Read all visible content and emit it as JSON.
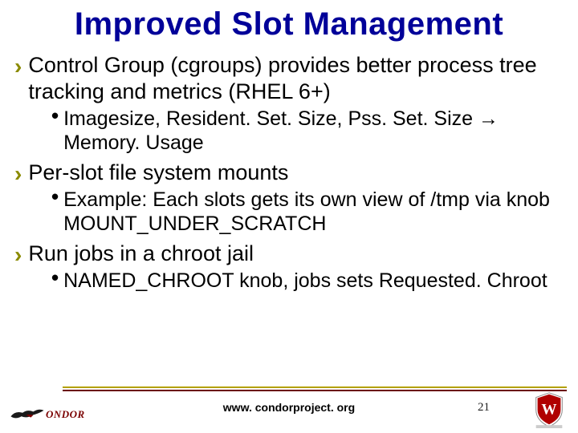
{
  "title": "Improved Slot Management",
  "bullets": {
    "b1": "Control Group (cgroups) provides better process tree tracking and metrics (RHEL 6+)",
    "b1a": "Imagesize, Resident. Set. Size, Pss. Set. Size → Memory. Usage",
    "b2": "Per-slot file system mounts",
    "b2a": "Example: Each slots gets its own view of /tmp via knob MOUNT_UNDER_SCRATCH",
    "b3": "Run jobs in a chroot jail",
    "b3a": "NAMED_CHROOT  knob, jobs sets Requested. Chroot"
  },
  "footer": {
    "url": "www. condorproject. org",
    "page": "21",
    "left_logo_text": "ONDOR"
  }
}
